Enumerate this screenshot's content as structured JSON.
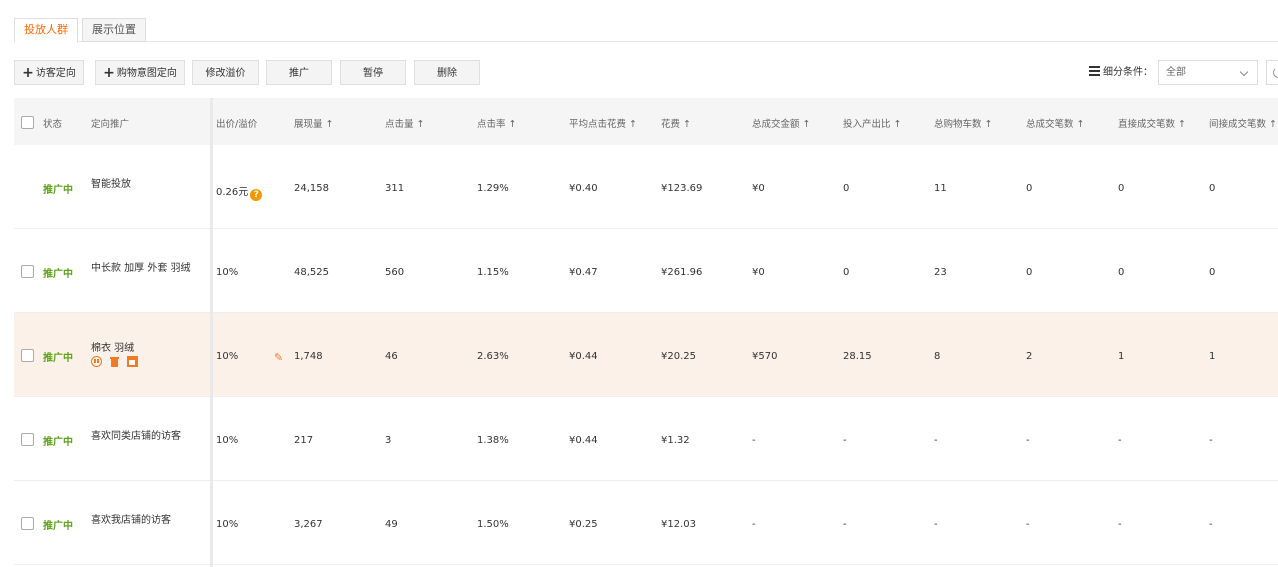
{
  "tabs": [
    "投放人群",
    "展示位置"
  ],
  "toolbar": {
    "add_visitor": "访客定向",
    "add_cart": "购物意图定向",
    "modify_premium": "修改溢价",
    "promote": "推广",
    "pause": "暂停",
    "delete": "删除"
  },
  "filter": {
    "label": "细分条件：",
    "value": "全部"
  },
  "table": {
    "headers": {
      "status": "状态",
      "target": "定向推广",
      "bid": "出价/溢价",
      "impressions": "展现量 ↑",
      "clicks": "点击量 ↑",
      "ctr": "点击率 ↑",
      "cpc": "平均点击花费 ↑",
      "cost": "花费 ↑",
      "gmv": "总成交金额 ↑",
      "roi": "投入产出比 ↑",
      "carts": "总购物车数 ↑",
      "orders": "总成交笔数 ↑",
      "direct": "直接成交笔数 ↑",
      "indirect": "间接成交笔数 ↑"
    },
    "rows": [
      {
        "status": "推广中",
        "name": "智能投放",
        "bid": "0.26元",
        "impressions": "24,158",
        "clicks": "311",
        "ctr": "1.29%",
        "cpc": "¥0.40",
        "cost": "¥123.69",
        "gmv": "¥0",
        "roi": "0",
        "carts": "11",
        "orders": "0",
        "direct": "0",
        "indirect": "0"
      },
      {
        "status": "推广中",
        "name": "中长款 加厚 外套 羽绒",
        "bid": "10%",
        "impressions": "48,525",
        "clicks": "560",
        "ctr": "1.15%",
        "cpc": "¥0.47",
        "cost": "¥261.96",
        "gmv": "¥0",
        "roi": "0",
        "carts": "23",
        "orders": "0",
        "direct": "0",
        "indirect": "0"
      },
      {
        "status": "推广中",
        "name": "棉衣 羽绒",
        "bid": "10%",
        "impressions": "1,748",
        "clicks": "46",
        "ctr": "2.63%",
        "cpc": "¥0.44",
        "cost": "¥20.25",
        "gmv": "¥570",
        "roi": "28.15",
        "carts": "8",
        "orders": "2",
        "direct": "1",
        "indirect": "1"
      },
      {
        "status": "推广中",
        "name": "喜欢同类店铺的访客",
        "bid": "10%",
        "impressions": "217",
        "clicks": "3",
        "ctr": "1.38%",
        "cpc": "¥0.44",
        "cost": "¥1.32",
        "gmv": "-",
        "roi": "-",
        "carts": "-",
        "orders": "-",
        "direct": "-",
        "indirect": "-"
      },
      {
        "status": "推广中",
        "name": "喜欢我店铺的访客",
        "bid": "10%",
        "impressions": "3,267",
        "clicks": "49",
        "ctr": "1.50%",
        "cpc": "¥0.25",
        "cost": "¥12.03",
        "gmv": "-",
        "roi": "-",
        "carts": "-",
        "orders": "-",
        "direct": "-",
        "indirect": "-"
      }
    ]
  },
  "icons": {
    "help": "?",
    "edit": "✎"
  },
  "colors": {
    "accent": "#ff6a00",
    "status": "#5ea21b",
    "highlight_row": "#fcf1e9"
  }
}
